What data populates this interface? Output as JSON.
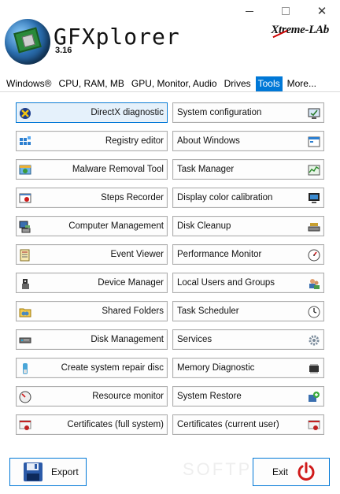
{
  "window": {
    "minimize_glyph": "—",
    "close_glyph": "✕"
  },
  "header": {
    "title": "GFXplorer",
    "version": "3.16",
    "brand": "Xtreme-LAb"
  },
  "tabs": [
    {
      "label": "Windows®",
      "active": false
    },
    {
      "label": "CPU, RAM, MB",
      "active": false
    },
    {
      "label": "GPU, Monitor, Audio",
      "active": false
    },
    {
      "label": "Drives",
      "active": false
    },
    {
      "label": "Tools",
      "active": true
    },
    {
      "label": "More...",
      "active": false
    }
  ],
  "tools": {
    "left": [
      {
        "label": "DirectX diagnostic",
        "icon": "directx-icon"
      },
      {
        "label": "Registry editor",
        "icon": "registry-icon"
      },
      {
        "label": "Malware Removal Tool",
        "icon": "malware-icon"
      },
      {
        "label": "Steps Recorder",
        "icon": "steps-recorder-icon"
      },
      {
        "label": "Computer Management",
        "icon": "computer-management-icon"
      },
      {
        "label": "Event Viewer",
        "icon": "event-viewer-icon"
      },
      {
        "label": "Device Manager",
        "icon": "device-manager-icon"
      },
      {
        "label": "Shared Folders",
        "icon": "shared-folders-icon"
      },
      {
        "label": "Disk Management",
        "icon": "disk-management-icon"
      },
      {
        "label": "Create system repair disc",
        "icon": "repair-disc-icon"
      },
      {
        "label": "Resource monitor",
        "icon": "resource-monitor-icon"
      },
      {
        "label": "Certificates (full system)",
        "icon": "certificates-icon"
      }
    ],
    "right": [
      {
        "label": "System configuration",
        "icon": "system-configuration-icon"
      },
      {
        "label": "About Windows",
        "icon": "about-windows-icon"
      },
      {
        "label": "Task Manager",
        "icon": "task-manager-icon"
      },
      {
        "label": "Display color calibration",
        "icon": "display-calibration-icon"
      },
      {
        "label": "Disk Cleanup",
        "icon": "disk-cleanup-icon"
      },
      {
        "label": "Performance Monitor",
        "icon": "performance-monitor-icon"
      },
      {
        "label": "Local Users and Groups",
        "icon": "users-groups-icon"
      },
      {
        "label": "Task Scheduler",
        "icon": "task-scheduler-icon"
      },
      {
        "label": "Services",
        "icon": "services-gear-icon"
      },
      {
        "label": "Memory Diagnostic",
        "icon": "memory-chip-icon"
      },
      {
        "label": "System Restore",
        "icon": "system-restore-icon"
      },
      {
        "label": "Certificates (current user)",
        "icon": "certificates-icon"
      }
    ]
  },
  "footer": {
    "export_label": "Export",
    "exit_label": "Exit"
  },
  "watermark": "SOFTPEDIA",
  "colors": {
    "accent": "#0078d7",
    "exit_red": "#d01a1a"
  }
}
